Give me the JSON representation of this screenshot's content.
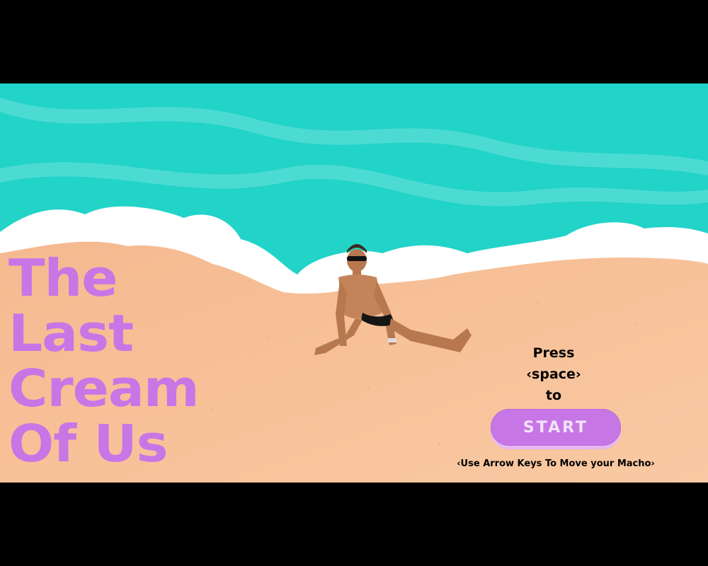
{
  "game": {
    "title_lines": [
      "The",
      "Last",
      "Cream",
      "Of Us"
    ],
    "prompt_lines": [
      "Press",
      "‹space›",
      "to"
    ],
    "start_label": "START",
    "hint": "‹Use Arrow Keys To Move your Macho›"
  },
  "colors": {
    "sea": "#22d3c8",
    "wave": "#5fe0d8",
    "foam": "#ffffff",
    "sand": "#f7c39b",
    "title": "#c776e6",
    "button": "#c776e6"
  },
  "player": {
    "icon": "player-character-icon"
  }
}
